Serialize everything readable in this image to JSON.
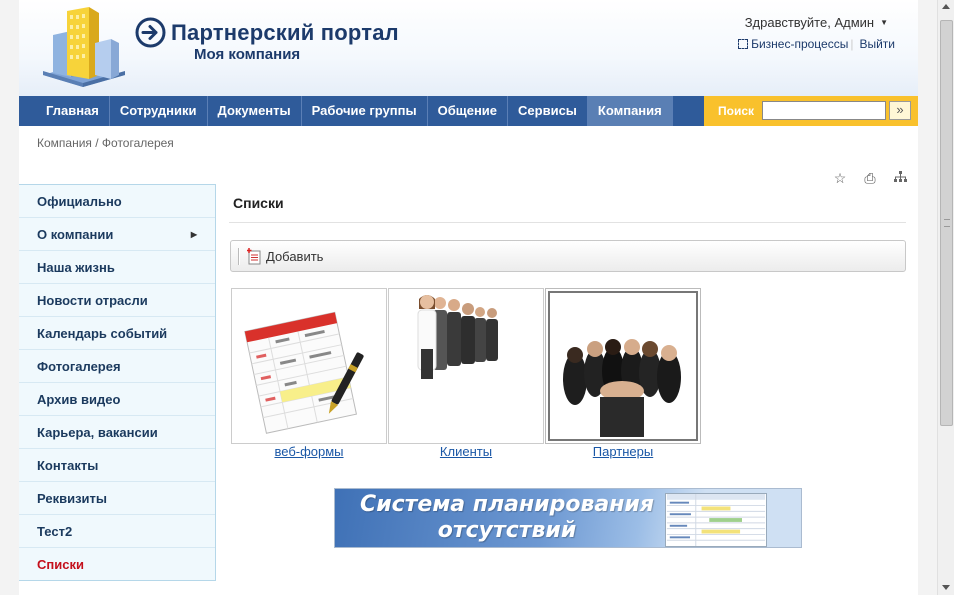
{
  "header": {
    "portal_title": "Партнерский портал",
    "company": "Моя компания",
    "greeting": "Здравствуйте, Админ",
    "business_processes": "Бизнес-процессы",
    "logout": "Выйти"
  },
  "nav": {
    "items": [
      "Главная",
      "Сотрудники",
      "Документы",
      "Рабочие группы",
      "Общение",
      "Сервисы",
      "Компания"
    ],
    "active": "Компания"
  },
  "search": {
    "label": "Поиск",
    "value": "",
    "button": "»"
  },
  "breadcrumb": "Компания / Фотогалерея",
  "sidebar": {
    "items": [
      {
        "label": "Официально"
      },
      {
        "label": "О компании",
        "has_submenu": true
      },
      {
        "label": "Наша жизнь"
      },
      {
        "label": "Новости отрасли"
      },
      {
        "label": "Календарь событий"
      },
      {
        "label": "Фотогалерея"
      },
      {
        "label": "Архив видео"
      },
      {
        "label": "Карьера, вакансии"
      },
      {
        "label": "Контакты"
      },
      {
        "label": "Реквизиты"
      },
      {
        "label": "Тест2"
      },
      {
        "label": "Списки",
        "active": true
      }
    ]
  },
  "content": {
    "title": "Списки",
    "add_button": "Добавить",
    "galleries": [
      {
        "caption": "веб-формы"
      },
      {
        "caption": "Клиенты"
      },
      {
        "caption": "Партнеры"
      }
    ],
    "banner": {
      "line1": "Система планирования",
      "line2": "отсутствий"
    }
  },
  "colors": {
    "nav_bg": "#2f5b9a",
    "nav_active": "#5a7fb4",
    "search_bg": "#f9c12c",
    "active_menu": "#c4101c",
    "link": "#1a57a6"
  }
}
